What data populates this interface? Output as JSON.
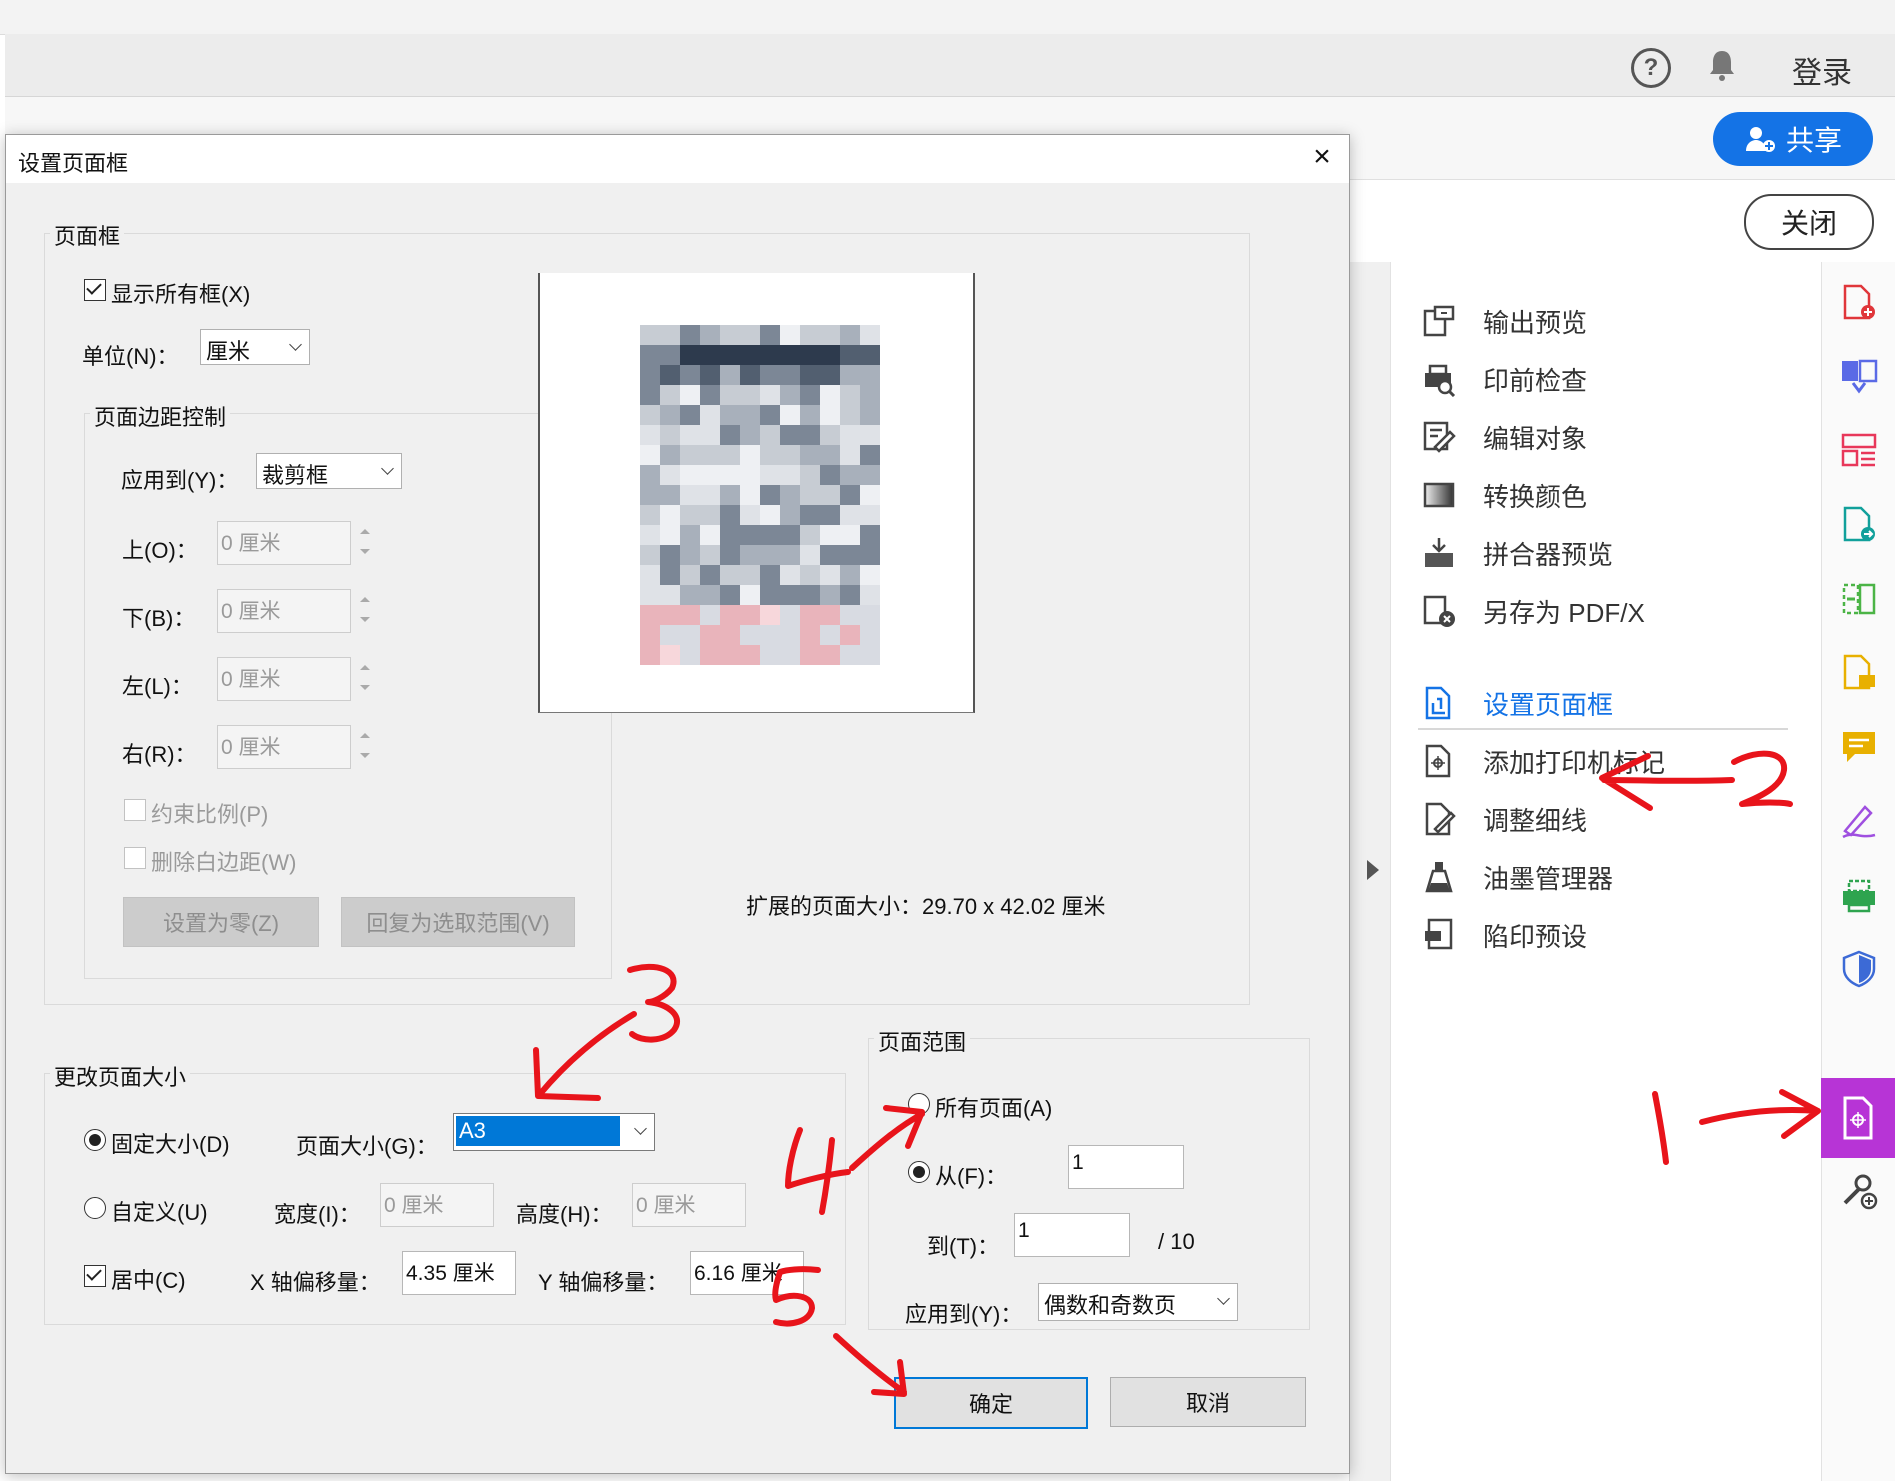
{
  "app": {
    "help_glyph": "?",
    "login_label": "登录",
    "share_label": "共享",
    "close_label": "关闭"
  },
  "tools_panel": {
    "items": [
      {
        "label": "输出预览",
        "icon": "output-preview-icon"
      },
      {
        "label": "印前检查",
        "icon": "preflight-icon"
      },
      {
        "label": "编辑对象",
        "icon": "edit-object-icon"
      },
      {
        "label": "转换颜色",
        "icon": "convert-colors-icon"
      },
      {
        "label": "拼合器预览",
        "icon": "flattener-preview-icon"
      },
      {
        "label": "另存为 PDF/X",
        "icon": "save-as-pdfx-icon"
      },
      {
        "label": "设置页面框",
        "icon": "set-page-boxes-icon"
      },
      {
        "label": "添加打印机标记",
        "icon": "add-printer-marks-icon"
      },
      {
        "label": "调整细线",
        "icon": "fix-hairlines-icon"
      },
      {
        "label": "油墨管理器",
        "icon": "ink-manager-icon"
      },
      {
        "label": "陷印预设",
        "icon": "trap-presets-icon"
      }
    ],
    "active_index": 6,
    "active_color": "#1473e6"
  },
  "icon_strip": {
    "icons": [
      "create-pdf-icon",
      "combine-files-icon",
      "organize-pages-icon",
      "export-pdf-icon",
      "compress-icon",
      "edit-pdf-icon",
      "comment-icon",
      "fill-sign-icon",
      "print-production-icon",
      "protect-icon",
      "print-production-active-icon",
      "pdf-info-icon",
      "more-tools-icon"
    ],
    "active_index": 10,
    "active_color": "#b734d6"
  },
  "dialog": {
    "title": "设置页面框",
    "close_glyph": "×",
    "page_boxes": {
      "group_label": "页面框",
      "show_all_boxes": {
        "label": "显示所有框(X)",
        "checked": true
      },
      "unit_label": "单位(N)：",
      "unit_value": "厘米",
      "margins": {
        "group_label": "页面边距控制",
        "apply_to_label": "应用到(Y)：",
        "apply_to_value": "裁剪框",
        "top_label": "上(O)：",
        "top_value": "0 厘米",
        "bottom_label": "下(B)：",
        "bottom_value": "0 厘米",
        "left_label": "左(L)：",
        "left_value": "0 厘米",
        "right_label": "右(R)：",
        "right_value": "0 厘米",
        "constrain_label": "约束比例(P)",
        "remove_white_label": "删除白边距(W)",
        "set_zero_label": "设置为零(Z)",
        "revert_label": "回复为选取范围(V)"
      },
      "extended_size_text": "扩展的页面大小：29.70 x 42.02 厘米"
    },
    "change_size": {
      "group_label": "更改页面大小",
      "fixed_label": "固定大小(D)",
      "fixed_selected": true,
      "page_size_label": "页面大小(G)：",
      "page_size_value": "A3",
      "custom_label": "自定义(U)",
      "width_label": "宽度(I)：",
      "width_value": "0 厘米",
      "height_label": "高度(H)：",
      "height_value": "0 厘米",
      "center_label": "居中(C)",
      "center_checked": true,
      "x_offset_label": "X 轴偏移量：",
      "x_offset_value": "4.35 厘米",
      "y_offset_label": "Y 轴偏移量：",
      "y_offset_value": "6.16 厘米"
    },
    "page_range": {
      "group_label": "页面范围",
      "all_pages_label": "所有页面(A)",
      "from_label": "从(F)：",
      "from_value": "1",
      "to_label": "到(T)：",
      "to_value": "1",
      "total_text": "/ 10",
      "apply_to_label": "应用到(Y)：",
      "apply_to_value": "偶数和奇数页"
    },
    "ok_label": "确定",
    "cancel_label": "取消"
  },
  "annotations": {
    "color": "#e8141b",
    "numbers": [
      "1",
      "2",
      "3",
      "4",
      "5"
    ]
  }
}
